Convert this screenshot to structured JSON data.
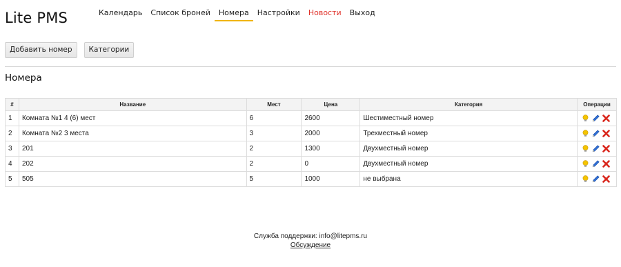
{
  "app": {
    "title": "Lite PMS"
  },
  "nav": {
    "items": [
      {
        "label": "Календарь"
      },
      {
        "label": "Список броней"
      },
      {
        "label": "Номера"
      },
      {
        "label": "Настройки"
      },
      {
        "label": "Новости"
      },
      {
        "label": "Выход"
      }
    ],
    "active": "Номера",
    "highlighted": "Новости"
  },
  "actions": {
    "add_room": "Добавить номер",
    "categories": "Категории"
  },
  "section": {
    "title": "Номера"
  },
  "table": {
    "headers": {
      "num": "#",
      "name": "Название",
      "seats": "Мест",
      "price": "Цена",
      "category": "Категория",
      "ops": "Операции"
    },
    "rows": [
      {
        "num": "1",
        "name": "Комната №1 4 (6) мест",
        "seats": "6",
        "price": "2600",
        "category": "Шестиместный номер"
      },
      {
        "num": "2",
        "name": "Комната №2 3 места",
        "seats": "3",
        "price": "2000",
        "category": "Трехместный номер"
      },
      {
        "num": "3",
        "name": "201",
        "seats": "2",
        "price": "1300",
        "category": "Двухместный номер"
      },
      {
        "num": "4",
        "name": "202",
        "seats": "2",
        "price": "0",
        "category": "Двухместный номер"
      },
      {
        "num": "5",
        "name": "505",
        "seats": "5",
        "price": "1000",
        "category": "не выбрана"
      }
    ],
    "row_icons": [
      "lightbulb-icon",
      "pencil-icon",
      "delete-icon"
    ]
  },
  "footer": {
    "support": "Служба поддержки: info@litepms.ru",
    "discussion": "Обсуждение"
  },
  "colors": {
    "active_underline": "#f0b400",
    "news_link": "#e0332b",
    "delete_icon": "#d9261c",
    "bulb_icon": "#f5c400",
    "pencil_icon": "#2f6fd6"
  }
}
